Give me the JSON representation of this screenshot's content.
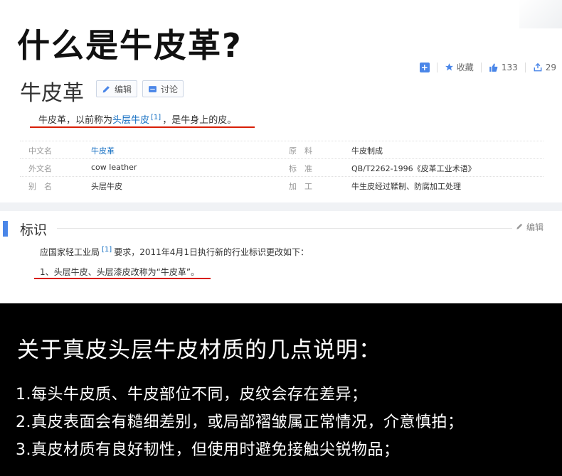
{
  "headline": "什么是牛皮革?",
  "toolbar": {
    "collect_label": "收藏",
    "like_count": "133",
    "share_count": "29"
  },
  "entry": {
    "title": "牛皮革",
    "edit_label": "编辑",
    "discuss_label": "讨论",
    "summary_prefix": "牛皮革，以前称为",
    "summary_link": "头层牛皮",
    "summary_ref": "[1]",
    "summary_suffix": "，是牛身上的皮。"
  },
  "info_table": [
    {
      "k1": "中文名",
      "v1": "牛皮革",
      "k2": "原　料",
      "v2": "牛皮制成"
    },
    {
      "k1": "外文名",
      "v1": "cow leather",
      "k2": "标　准",
      "v2": "QB/T2262-1996《皮革工业术语》"
    },
    {
      "k1": "别　名",
      "v1": "头层牛皮",
      "k2": "加　工",
      "v2": "牛生皮经过鞣制、防腐加工处理"
    }
  ],
  "section": {
    "title": "标识",
    "edit_label": "编辑",
    "p1_prefix": "应国家轻工业局",
    "p1_ref": "[1]",
    "p1_suffix": "要求，2011年4月1日执行新的行业标识更改如下：",
    "p2": "1、头层牛皮、头层漆皮改称为“牛皮革”。"
  },
  "notes": {
    "title": "关于真皮头层牛皮材质的几点说明：",
    "items": [
      "1.每头牛皮质、牛皮部位不同，皮纹会存在差异；",
      "2.真皮表面会有糙细差别，或局部褶皱属正常情况，介意慎拍；",
      "3.真皮材质有良好韧性，但使用时避免接触尖锐物品；"
    ]
  },
  "colors": {
    "accent": "#4a86e8",
    "link": "#136ec2",
    "underline": "#d81e06",
    "dark_bg": "#000000"
  }
}
